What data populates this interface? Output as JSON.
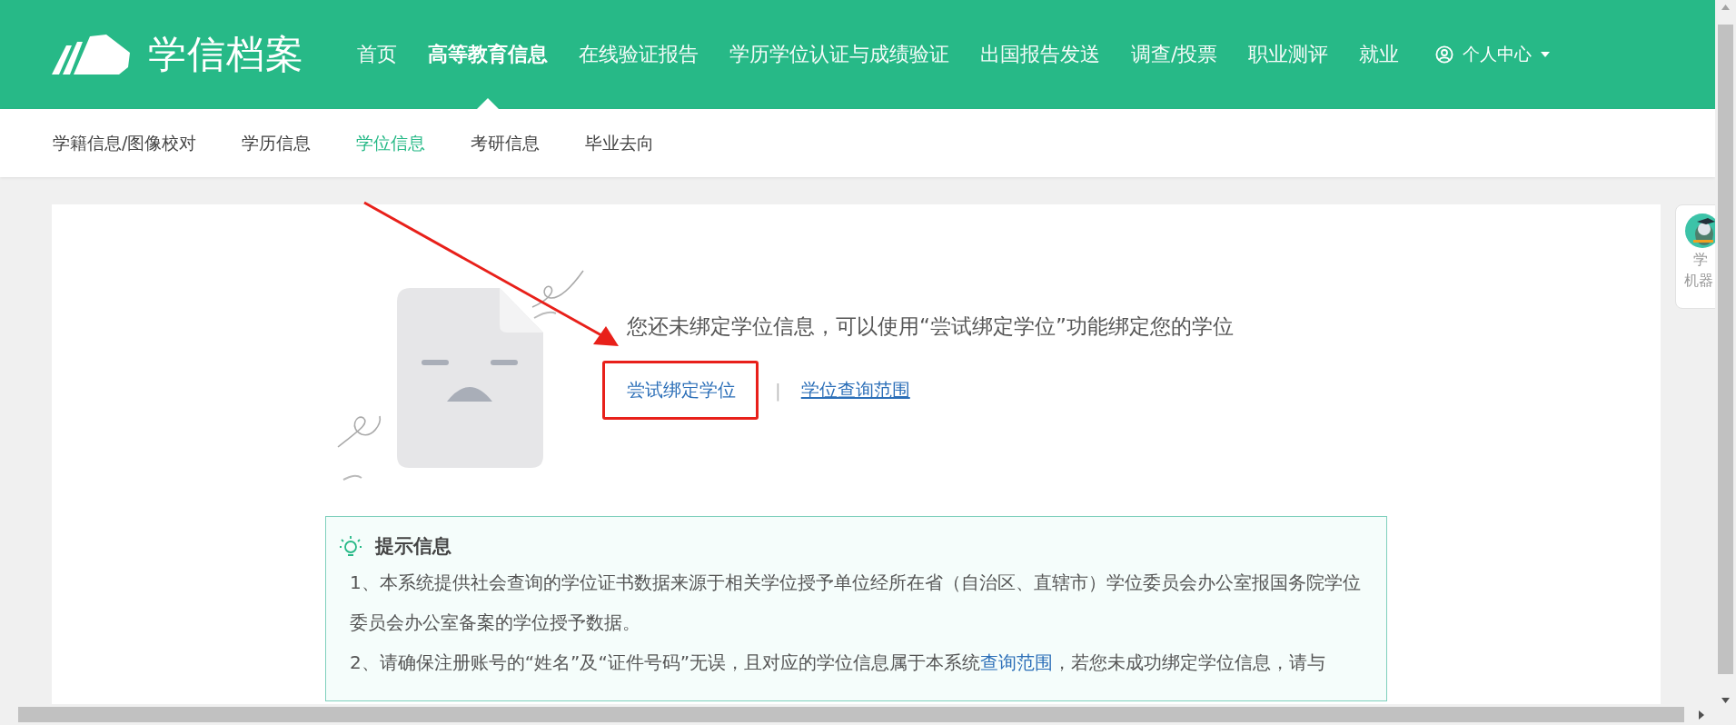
{
  "header": {
    "logo_text": "学信档案",
    "nav": [
      {
        "label": "首页",
        "selected": false
      },
      {
        "label": "高等教育信息",
        "selected": true
      },
      {
        "label": "在线验证报告",
        "selected": false
      },
      {
        "label": "学历学位认证与成绩验证",
        "selected": false
      },
      {
        "label": "出国报告发送",
        "selected": false
      },
      {
        "label": "调查/投票",
        "selected": false
      },
      {
        "label": "职业测评",
        "selected": false
      },
      {
        "label": "就业",
        "selected": false
      }
    ],
    "user_menu": "个人中心"
  },
  "subnav": [
    {
      "label": "学籍信息/图像校对",
      "selected": false
    },
    {
      "label": "学历信息",
      "selected": false
    },
    {
      "label": "学位信息",
      "selected": true
    },
    {
      "label": "考研信息",
      "selected": false
    },
    {
      "label": "毕业去向",
      "selected": false
    }
  ],
  "notice": {
    "message": "您还未绑定学位信息，可以使用“尝试绑定学位”功能绑定您的学位",
    "links": [
      {
        "label": "尝试绑定学位",
        "highlighted": true,
        "underline": false
      },
      {
        "label": "学位查询范围",
        "highlighted": false,
        "underline": true
      }
    ],
    "separator": "|"
  },
  "tips": {
    "title": "提示信息",
    "paragraphs": [
      [
        {
          "text": "1、本系统提供社会查询的学位证书数据来源于相关学位授予单位经所在省（自治区、直辖市）学位委员会办公室报国务院学位委员会办公室备案的学位授予数据。",
          "kind": "text"
        }
      ],
      [
        {
          "text": "2、请确保注册账号的“姓名”及“证件号码”无误，且对应的学位信息属于本系统",
          "kind": "text"
        },
        {
          "text": "查询范围",
          "kind": "link"
        },
        {
          "text": "，若您未成功绑定学位信息，请与",
          "kind": "text"
        }
      ]
    ]
  },
  "side_widget": {
    "lines": [
      "学",
      "机器"
    ]
  }
}
